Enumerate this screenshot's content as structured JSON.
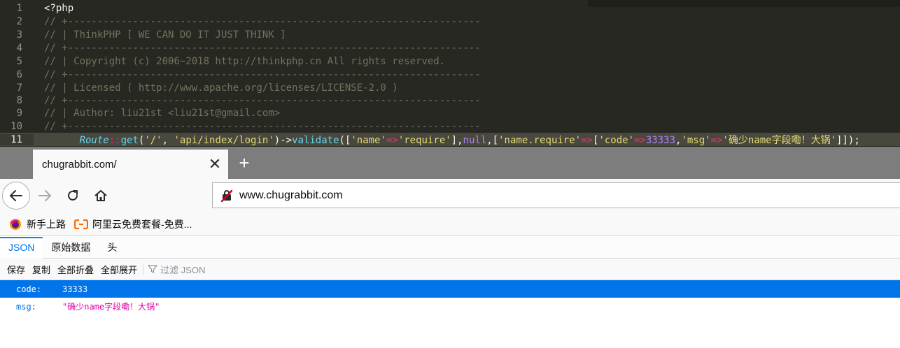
{
  "editor": {
    "lines": [
      {
        "num": "1",
        "text": "<?php",
        "kind": "plain"
      },
      {
        "num": "2",
        "text": "// +----------------------------------------------------------------------",
        "kind": "comment"
      },
      {
        "num": "3",
        "text": "// | ThinkPHP [ WE CAN DO IT JUST THINK ]",
        "kind": "comment"
      },
      {
        "num": "4",
        "text": "// +----------------------------------------------------------------------",
        "kind": "comment"
      },
      {
        "num": "5",
        "text": "// | Copyright (c) 2006~2018 http://thinkphp.cn All rights reserved.",
        "kind": "comment"
      },
      {
        "num": "6",
        "text": "// +----------------------------------------------------------------------",
        "kind": "comment"
      },
      {
        "num": "7",
        "text": "// | Licensed ( http://www.apache.org/licenses/LICENSE-2.0 )",
        "kind": "comment"
      },
      {
        "num": "8",
        "text": "// +----------------------------------------------------------------------",
        "kind": "comment"
      },
      {
        "num": "9",
        "text": "// | Author: liu21st <liu21st@gmail.com>",
        "kind": "comment"
      },
      {
        "num": "10",
        "text": "// +----------------------------------------------------------------------",
        "kind": "comment"
      }
    ],
    "active_line": {
      "num": "11",
      "tokens": [
        {
          "t": "Route",
          "c": "cls"
        },
        {
          "t": "::",
          "c": "op"
        },
        {
          "t": "get",
          "c": "fn"
        },
        {
          "t": "(",
          "c": "plain"
        },
        {
          "t": "'/'",
          "c": "str"
        },
        {
          "t": ", ",
          "c": "plain"
        },
        {
          "t": "'api/index/login'",
          "c": "str"
        },
        {
          "t": ")->",
          "c": "plain"
        },
        {
          "t": "validate",
          "c": "fn"
        },
        {
          "t": "([",
          "c": "plain"
        },
        {
          "t": "'name'",
          "c": "str"
        },
        {
          "t": "=>",
          "c": "op"
        },
        {
          "t": "'require'",
          "c": "str"
        },
        {
          "t": "],",
          "c": "plain"
        },
        {
          "t": "null",
          "c": "kw"
        },
        {
          "t": ",[",
          "c": "plain"
        },
        {
          "t": "'name.require'",
          "c": "str"
        },
        {
          "t": "=>",
          "c": "op"
        },
        {
          "t": "[",
          "c": "plain"
        },
        {
          "t": "'code'",
          "c": "str"
        },
        {
          "t": "=>",
          "c": "op"
        },
        {
          "t": "33333",
          "c": "num"
        },
        {
          "t": ",",
          "c": "plain"
        },
        {
          "t": "'msg'",
          "c": "str"
        },
        {
          "t": "=>",
          "c": "op"
        },
        {
          "t": "'确少name字段嘞！大锅'",
          "c": "str"
        },
        {
          "t": "]]);",
          "c": "plain"
        }
      ]
    }
  },
  "browser": {
    "tab_title": "chugrabbit.com/",
    "tab_close": "✕",
    "new_tab": "+",
    "url": "www.chugrabbit.com",
    "bookmarks": [
      {
        "label": "新手上路"
      },
      {
        "label": "阿里云免费套餐-免费..."
      }
    ]
  },
  "json_viewer": {
    "tabs": [
      "JSON",
      "原始数据",
      "头"
    ],
    "toolbar": {
      "save": "保存",
      "copy": "复制",
      "collapse_all": "全部折叠",
      "expand_all": "全部展开",
      "filter": "过滤 JSON"
    },
    "rows": [
      {
        "key": "code:",
        "value": "33333",
        "type": "num"
      },
      {
        "key": "msg:",
        "value": "\"确少name字段嘞！大锅\"",
        "type": "str"
      }
    ]
  },
  "colors": {
    "editor_bg": "#272822",
    "accent_blue": "#0074e8",
    "string_pink": "#dd00a9"
  }
}
